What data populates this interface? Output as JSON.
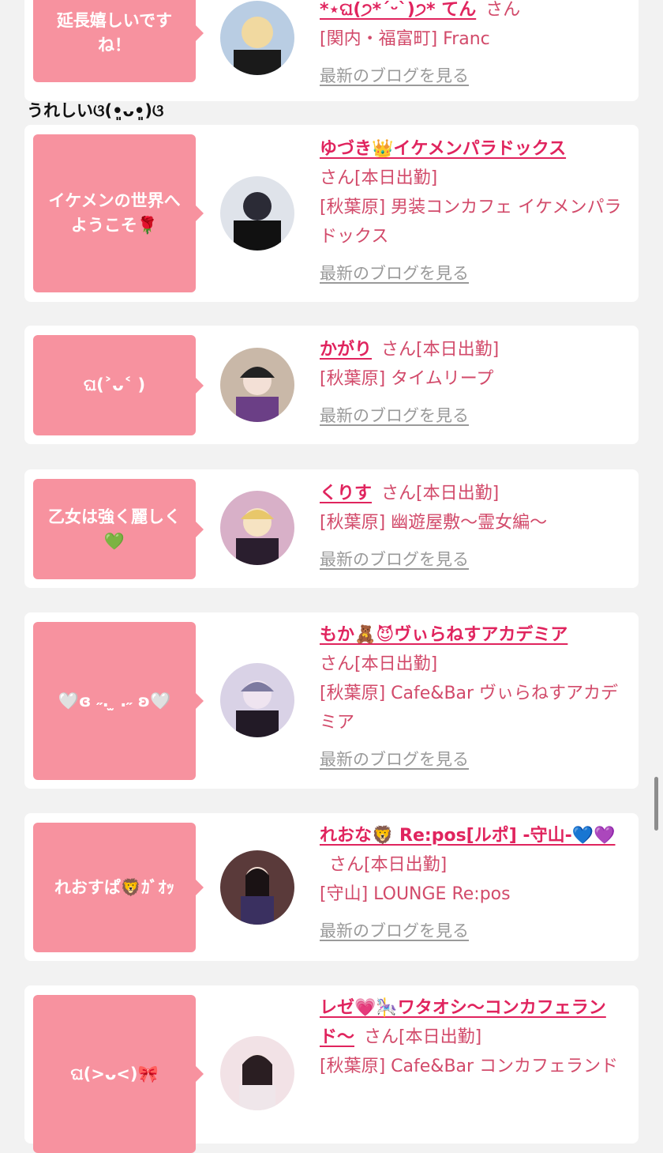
{
  "entries": [
    {
      "bubble": "延長嬉しいですね！",
      "name": "*⋆ଘ(੭*ˊᵕˋ)੭* てん",
      "san": "さん",
      "shop": "[関内・福富町] Franc",
      "blog": "最新のブログを見る"
    },
    {
      "bubble": "イケメンの世界へようこそ🌹",
      "name": "ゆづき👑イケメンパラドックス",
      "san": "さん[本日出勤]",
      "shop": "[秋葉原] 男装コンカフェ イケメンパラドックス",
      "blog": "最新のブログを見る"
    },
    {
      "bubble": "ଘ(˃ᴗ˂ )",
      "name": "かがり",
      "san": "さん[本日出勤]",
      "shop": "[秋葉原] タイムリープ",
      "blog": "最新のブログを見る"
    },
    {
      "bubble": "乙女は強く麗しく💚",
      "name": "くりす",
      "san": "さん[本日出勤]",
      "shop": "[秋葉原] 幽遊屋敷〜霊女編〜",
      "blog": "最新のブログを見る"
    },
    {
      "bubble": "🤍ɞ ˶. ̫ .˶ ʚ🤍",
      "name": "もか🧸😈ヴぃらねすアカデミア",
      "san": "さん[本日出勤]",
      "shop": "[秋葉原] Cafe&Bar ヴぃらねすアカデミア",
      "blog": "最新のブログを見る"
    },
    {
      "bubble": "れおすぱ🦁ｶﾞｵｯ",
      "name": "れおな🦁 Re:pos[ルポ] -守山-💙💜",
      "san": "さん[本日出勤]",
      "shop": "[守山] LOUNGE Re:pos",
      "blog": "最新のブログを見る"
    },
    {
      "bubble": "ଘ(>ᴗ<)🎀",
      "name": "レゼ💗🎠ワタオシ〜コンカフェランド〜",
      "san": "さん[本日出勤]",
      "shop": "[秋葉原] Cafe&Bar コンカフェランド",
      "blog": ""
    }
  ],
  "comment": "うれしいଓ(•͈ᴗ•͈)ଓ",
  "avatar_colors": [
    "#b9cde3",
    "#2a2a38",
    "#c9b8a8",
    "#d8b0c8",
    "#d9d2e6",
    "#5a3a3a",
    "#f2e2e6"
  ]
}
